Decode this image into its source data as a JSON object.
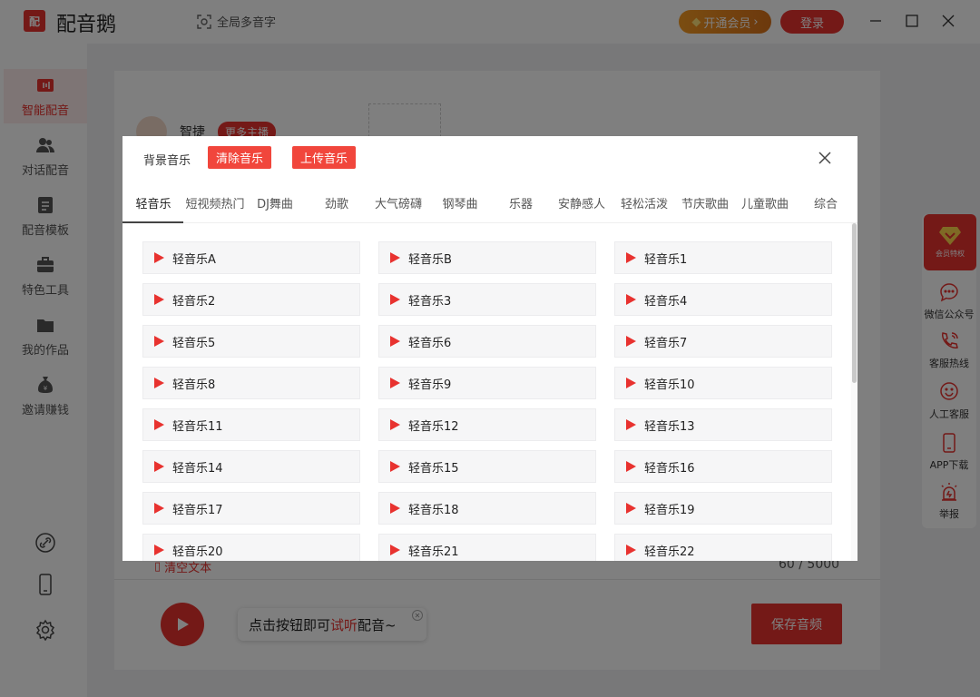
{
  "app": {
    "logo_text": "配",
    "name": "配音鹅",
    "poly_label": "全局多音字",
    "vip_label": "开通会员",
    "login_label": "登录"
  },
  "sidebar": {
    "items": [
      {
        "label": "智能配音",
        "icon": "sound-wave-icon"
      },
      {
        "label": "对话配音",
        "icon": "users-icon"
      },
      {
        "label": "配音模板",
        "icon": "document-icon"
      },
      {
        "label": "特色工具",
        "icon": "toolbox-icon"
      },
      {
        "label": "我的作品",
        "icon": "folder-icon"
      },
      {
        "label": "邀请赚钱",
        "icon": "money-bag-icon"
      }
    ],
    "bottom_icons": [
      "link-icon",
      "phone-icon",
      "settings-icon"
    ]
  },
  "editor": {
    "voice_name": "智捷",
    "more_anchor": "更多主播",
    "clear_text": "清空文本",
    "char_count": "60 / 5000",
    "tooltip_prefix": "点击按钮即可",
    "tooltip_highlight": "试听",
    "tooltip_suffix": "配音~",
    "save_label": "保存音频"
  },
  "right_panel": {
    "vip_badge": "会员特权",
    "items": [
      {
        "label": "微信公众号",
        "icon": "chat-icon"
      },
      {
        "label": "客服热线",
        "icon": "phone-call-icon"
      },
      {
        "label": "人工客服",
        "icon": "smile-icon"
      },
      {
        "label": "APP下载",
        "icon": "mobile-icon"
      },
      {
        "label": "举报",
        "icon": "alarm-icon"
      }
    ]
  },
  "modal": {
    "title": "背景音乐",
    "clear_label": "清除音乐",
    "upload_label": "上传音乐",
    "tabs": [
      "轻音乐",
      "短视频热门",
      "DJ舞曲",
      "劲歌",
      "大气磅礴",
      "钢琴曲",
      "乐器",
      "安静感人",
      "轻松活泼",
      "节庆歌曲",
      "儿童歌曲",
      "综合"
    ],
    "active_tab": 0,
    "tracks": [
      "轻音乐A",
      "轻音乐B",
      "轻音乐1",
      "轻音乐2",
      "轻音乐3",
      "轻音乐4",
      "轻音乐5",
      "轻音乐6",
      "轻音乐7",
      "轻音乐8",
      "轻音乐9",
      "轻音乐10",
      "轻音乐11",
      "轻音乐12",
      "轻音乐13",
      "轻音乐14",
      "轻音乐15",
      "轻音乐16",
      "轻音乐17",
      "轻音乐18",
      "轻音乐19",
      "轻音乐20",
      "轻音乐21",
      "轻音乐22"
    ]
  },
  "colors": {
    "brand_red": "#e8322f",
    "button_red": "#f1463c",
    "vip_orange": "#f59a23"
  }
}
